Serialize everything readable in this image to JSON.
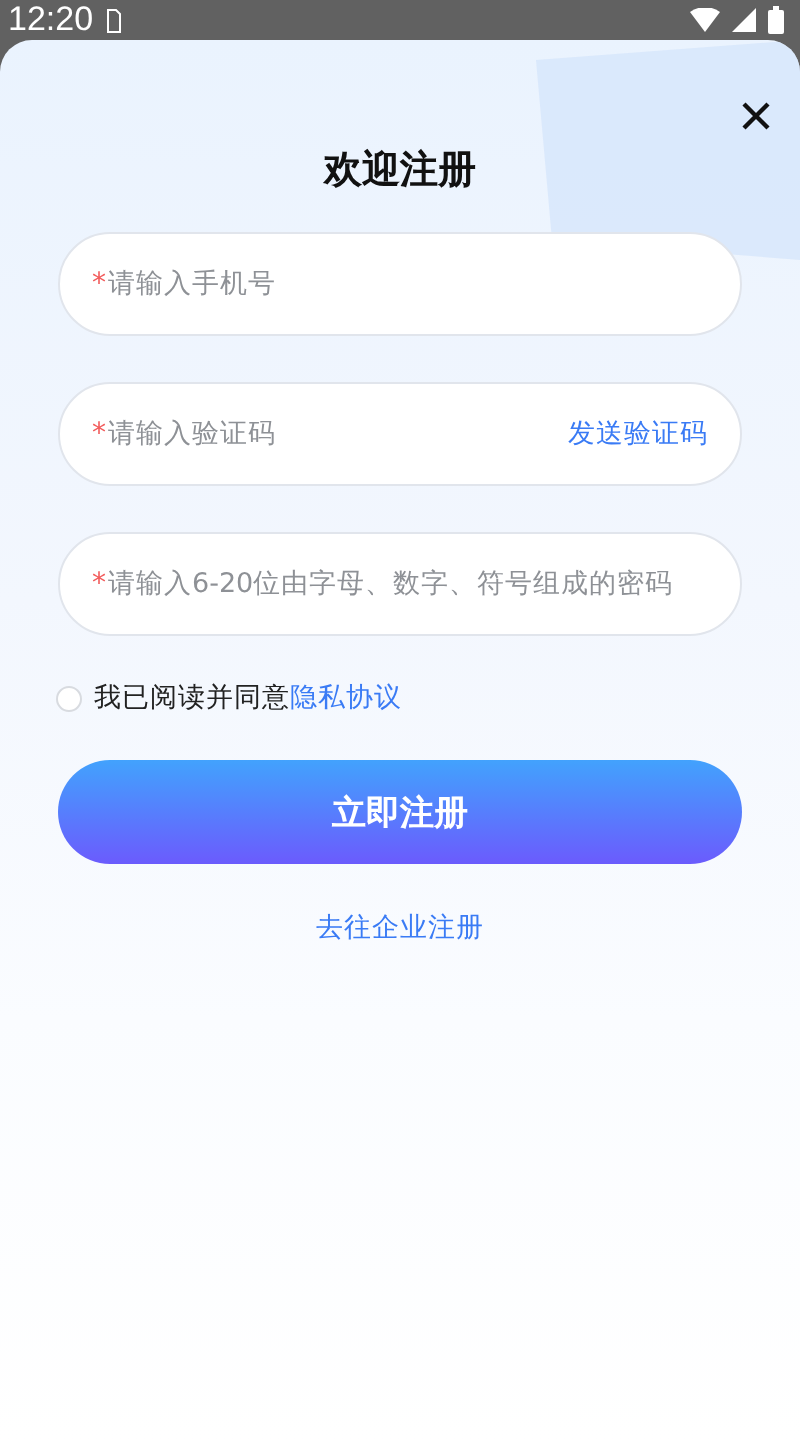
{
  "status_bar": {
    "time": "12:20"
  },
  "title": "欢迎注册",
  "fields": [
    {
      "kind": "plain",
      "required_mark": "*",
      "placeholder": "请输入手机号"
    },
    {
      "kind": "code",
      "required_mark": "*",
      "placeholder": "请输入验证码",
      "action": "发送验证码"
    },
    {
      "kind": "plain",
      "required_mark": "*",
      "placeholder": "请输入6-20位由字母、数字、符号组成的密码"
    }
  ],
  "agreement": {
    "checked": false,
    "text": "我已阅读并同意",
    "link": "隐私协议"
  },
  "submit_button": "立即注册",
  "enterprise_link": "去往企业注册"
}
